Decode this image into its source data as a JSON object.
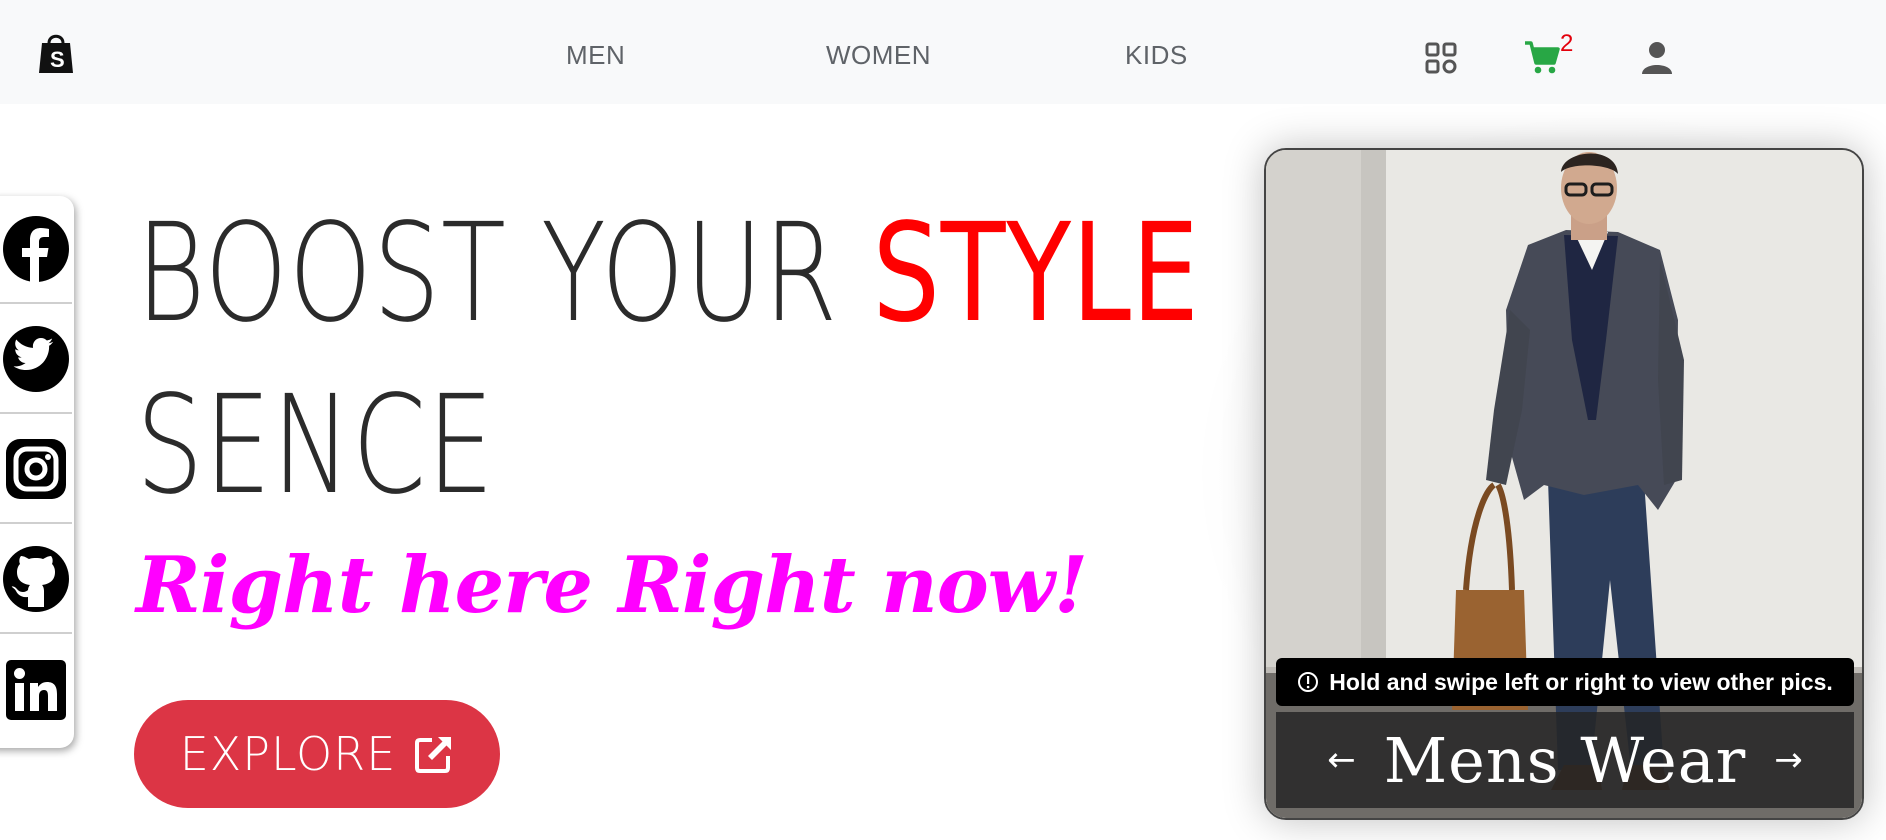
{
  "navbar": {
    "logo_icon": "shopping-bag-logo-icon",
    "links": [
      "MEN",
      "WOMEN",
      "KIDS"
    ],
    "cart_count": "2",
    "icons": [
      "grid-icon",
      "cart-icon",
      "user-icon"
    ],
    "cart_color": "#28a745"
  },
  "social": [
    "facebook-icon",
    "twitter-icon",
    "instagram-icon",
    "github-icon",
    "linkedin-icon"
  ],
  "hero": {
    "line1_prefix": "BOOST YOUR ",
    "line1_accent": "STYLE",
    "line2": "SENCE",
    "tagline": "Right here Right now!",
    "accent_color": "#ff0000",
    "tagline_color": "#ff00ff"
  },
  "explore": {
    "label": "EXPLORE",
    "icon": "external-link-icon",
    "color": "#dc3545"
  },
  "carousel": {
    "hint": "Hold and swipe left or right to view other pics.",
    "hint_icon": "info-circle-icon",
    "title": "Mens Wear",
    "prev": "←",
    "next": "→"
  }
}
